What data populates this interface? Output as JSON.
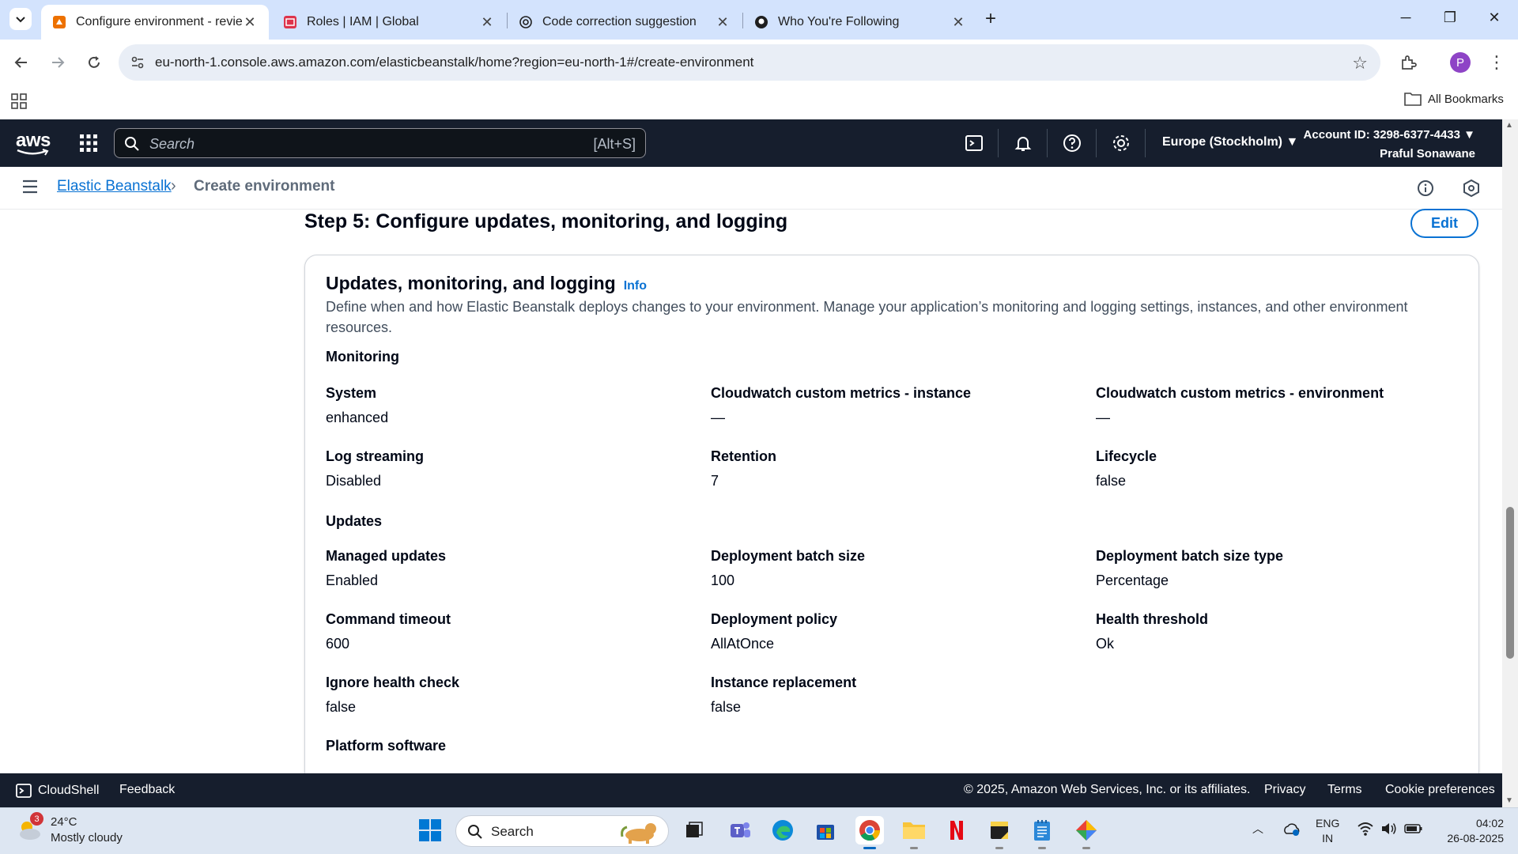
{
  "browser": {
    "tabs": [
      {
        "label": "Configure environment - review",
        "active": true
      },
      {
        "label": "Roles | IAM | Global",
        "active": false
      },
      {
        "label": "Code correction suggestion",
        "active": false
      },
      {
        "label": "Who You're Following",
        "active": false
      }
    ],
    "url": "eu-north-1.console.aws.amazon.com/elasticbeanstalk/home?region=eu-north-1#/create-environment",
    "bookmarks_label": "All Bookmarks",
    "profile_initial": "P"
  },
  "aws_nav": {
    "logo_text": "aws",
    "search_placeholder": "Search",
    "search_shortcut": "[Alt+S]",
    "region": "Europe (Stockholm)",
    "account_id": "Account ID: 3298-6377-4433",
    "user_name": "Praful Sonawane"
  },
  "breadcrumb": {
    "parent": "Elastic Beanstalk",
    "current": "Create environment"
  },
  "step": {
    "title": "Step 5: Configure updates, monitoring, and logging",
    "edit_label": "Edit"
  },
  "card": {
    "title": "Updates, monitoring, and logging",
    "info_label": "Info",
    "description": "Define when and how Elastic Beanstalk deploys changes to your environment. Manage your application’s monitoring and logging settings, instances, and other environment resources.",
    "monitoring_label": "Monitoring",
    "monitoring": [
      {
        "key": "System",
        "value": "enhanced"
      },
      {
        "key": "Cloudwatch custom metrics - instance",
        "value": "—"
      },
      {
        "key": "Cloudwatch custom metrics - environment",
        "value": "—"
      },
      {
        "key": "Log streaming",
        "value": "Disabled"
      },
      {
        "key": "Retention",
        "value": "7"
      },
      {
        "key": "Lifecycle",
        "value": "false"
      }
    ],
    "updates_label": "Updates",
    "updates": [
      {
        "key": "Managed updates",
        "value": "Enabled"
      },
      {
        "key": "Deployment batch size",
        "value": "100"
      },
      {
        "key": "Deployment batch size type",
        "value": "Percentage"
      },
      {
        "key": "Command timeout",
        "value": "600"
      },
      {
        "key": "Deployment policy",
        "value": "AllAtOnce"
      },
      {
        "key": "Health threshold",
        "value": "Ok"
      },
      {
        "key": "Ignore health check",
        "value": "false"
      },
      {
        "key": "Instance replacement",
        "value": "false"
      }
    ],
    "platform_label": "Platform software"
  },
  "footer": {
    "cloudshell": "CloudShell",
    "feedback": "Feedback",
    "copyright": "© 2025, Amazon Web Services, Inc. or its affiliates.",
    "privacy": "Privacy",
    "terms": "Terms",
    "cookies": "Cookie preferences"
  },
  "taskbar": {
    "weather_temp": "24°C",
    "weather_desc": "Mostly cloudy",
    "weather_badge": "3",
    "search_label": "Search",
    "lang_top": "ENG",
    "lang_bottom": "IN",
    "time": "04:02",
    "date": "26-08-2025"
  },
  "colors": {
    "aws_nav_bg": "#161e2d",
    "link_blue": "#0972d3",
    "tabstrip_bg": "#d3e3fd"
  }
}
